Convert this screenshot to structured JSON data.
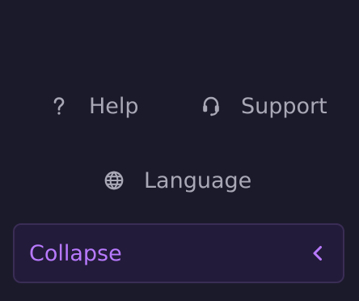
{
  "footer": {
    "links": [
      {
        "label": "Help",
        "icon": "question-icon"
      },
      {
        "label": "Support",
        "icon": "headset-icon"
      },
      {
        "label": "Language",
        "icon": "globe-icon"
      }
    ]
  },
  "collapse": {
    "label": "Collapse",
    "icon": "chevron-left-icon"
  },
  "colors": {
    "background": "#1b1a2b",
    "text": "#a9a8b6",
    "accent": "#b87aff",
    "collapse_bg": "#231b3a",
    "collapse_border": "#3a2d55"
  }
}
